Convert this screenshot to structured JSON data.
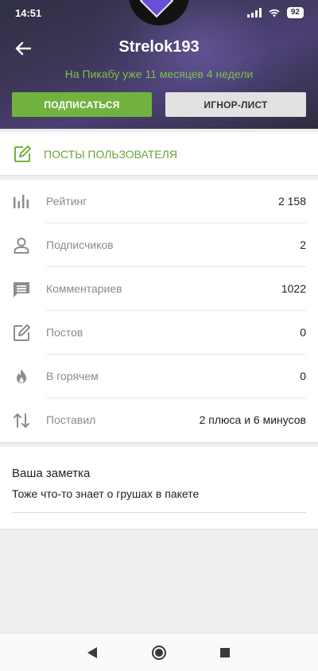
{
  "status_bar": {
    "time": "14:51",
    "battery": "92",
    "icons": [
      "signal-icon",
      "wifi-icon",
      "battery-icon"
    ]
  },
  "profile": {
    "username": "Strelok193",
    "since": "На Пикабу уже 11 месяцев 4 недели",
    "subscribe_label": "ПОДПИСАТЬСЯ",
    "ignore_label": "ИГНОР-ЛИСТ"
  },
  "posts_link": {
    "label": "ПОСТЫ ПОЛЬЗОВАТЕЛЯ",
    "icon": "edit-icon"
  },
  "stats": [
    {
      "icon": "bar-chart-icon",
      "label": "Рейтинг",
      "value": "2 158"
    },
    {
      "icon": "person-icon",
      "label": "Подписчиков",
      "value": "2"
    },
    {
      "icon": "comment-icon",
      "label": "Комментариев",
      "value": "1022"
    },
    {
      "icon": "edit-icon",
      "label": "Постов",
      "value": "0"
    },
    {
      "icon": "flame-icon",
      "label": "В горячем",
      "value": "0"
    },
    {
      "icon": "swap-vert-icon",
      "label": "Поставил",
      "value": "2 плюса и 6 минусов"
    }
  ],
  "note": {
    "title": "Ваша заметка",
    "text": "Тоже что-то знает о грушах в пакете"
  },
  "colors": {
    "accent_green": "#72b340",
    "since_green": "#7fbf4d",
    "ignore_button_bg": "#e2e2e2"
  }
}
